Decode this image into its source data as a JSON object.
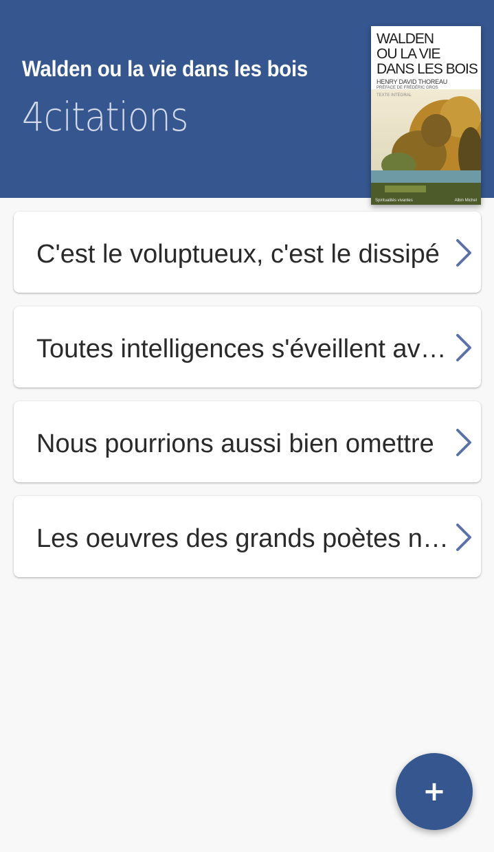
{
  "header": {
    "title": "Walden ou la vie dans les bois",
    "count": "4",
    "count_label": "citations"
  },
  "cover": {
    "title_lines": [
      "WALDEN",
      "OU LA VIE",
      "DANS LES BOIS"
    ],
    "author": "HENRY DAVID THOREAU",
    "preface": "PRÉFACE DE FRÉDÉRIC GROS",
    "edition": "TEXTE INTÉGRAL",
    "publisher": "Albin Michel",
    "collection": "Spiritualités vivantes"
  },
  "quotes": [
    {
      "text": "C'est le voluptueux, c'est le dissipé"
    },
    {
      "text": "Toutes intelligences s'éveillent avec le matin"
    },
    {
      "text": "Nous pourrions aussi bien omettre"
    },
    {
      "text": "Les oeuvres des grands poètes n'ont"
    }
  ],
  "fab": {
    "icon": "plus-icon",
    "label": "+"
  },
  "colors": {
    "primary": "#36568f",
    "background": "#f8f8f8"
  }
}
